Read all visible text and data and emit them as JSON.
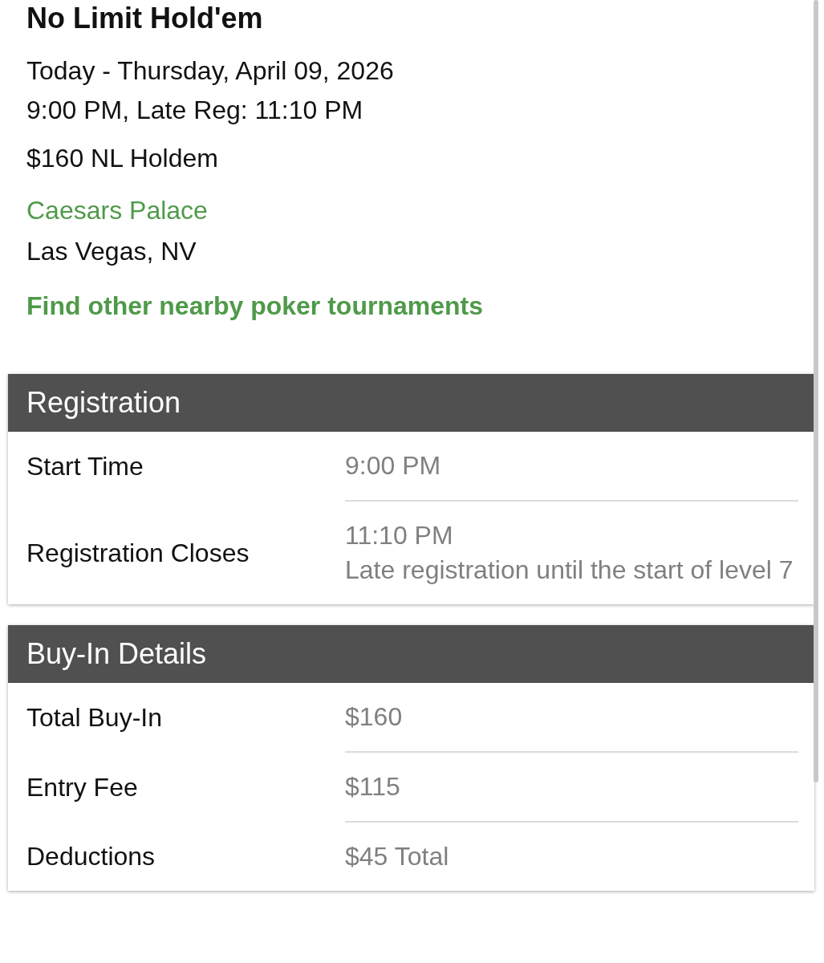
{
  "title": "No Limit Hold'em",
  "date": "Today - Thursday, April 09, 2026",
  "time": "9:00 PM, Late Reg: 11:10 PM",
  "event": "$160 NL Holdem",
  "venue": "Caesars Palace",
  "location": "Las Vegas, NV",
  "nearby_link": "Find other nearby poker tournaments",
  "sections": [
    {
      "title": "Registration",
      "rows": [
        {
          "label": "Start Time",
          "value": "9:00 PM"
        },
        {
          "label": "Registration Closes",
          "value": "11:10 PM",
          "note": "Late registration until the start of level 7"
        }
      ]
    },
    {
      "title": "Buy-In Details",
      "rows": [
        {
          "label": "Total Buy-In",
          "value": "$160"
        },
        {
          "label": "Entry Fee",
          "value": "$115"
        },
        {
          "label": "Deductions",
          "value": "$45 Total"
        }
      ]
    }
  ]
}
